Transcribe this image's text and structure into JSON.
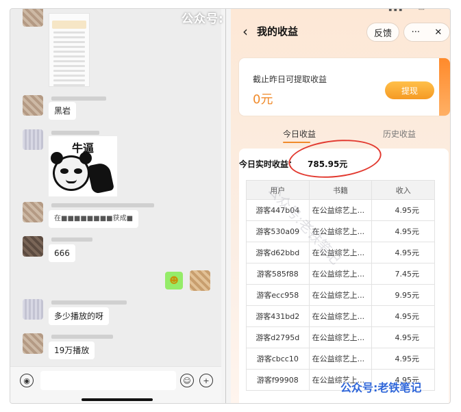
{
  "chat": {
    "messages": [
      {
        "text": "黑岩"
      },
      {
        "sticker_caption": "牛逼"
      },
      {
        "text": "在■■■■■■■■获成■"
      },
      {
        "text": "666"
      },
      {
        "sent_emoji": "☻"
      },
      {
        "text": "多少播放的呀"
      },
      {
        "text": "19万播放"
      }
    ]
  },
  "earnings": {
    "watermark_top": "公众号:",
    "title": "我的收益",
    "feedback_label": "反馈",
    "more_label": "···",
    "close_label": "✕",
    "back_label": "‹",
    "withdrawable_label": "截止昨日可提取收益",
    "withdrawable_amount": "0元",
    "withdraw_button": "提现",
    "tabs": [
      "今日收益",
      "历史收益"
    ],
    "realtime_label": "今日实时收益：",
    "realtime_value": "785.95元",
    "table": {
      "headers": [
        "用户",
        "书籍",
        "收入"
      ],
      "rows": [
        [
          "游客447b04",
          "在公益综艺上...",
          "4.95元"
        ],
        [
          "游客530a09",
          "在公益综艺上...",
          "4.95元"
        ],
        [
          "游客d62bbd",
          "在公益综艺上...",
          "4.95元"
        ],
        [
          "游客585f88",
          "在公益综艺上...",
          "7.45元"
        ],
        [
          "游客ecc958",
          "在公益综艺上...",
          "9.95元"
        ],
        [
          "游客431bd2",
          "在公益综艺上...",
          "4.95元"
        ],
        [
          "游客d2795d",
          "在公益综艺上...",
          "4.95元"
        ],
        [
          "游客cbcc10",
          "在公益综艺上...",
          "4.95元"
        ],
        [
          "游客f99908",
          "在公益综艺上...",
          "4.95元"
        ]
      ]
    },
    "diagonal_watermark": "公众号:老铁笔记",
    "watermark_bottom": "公众号:老铁笔记"
  }
}
